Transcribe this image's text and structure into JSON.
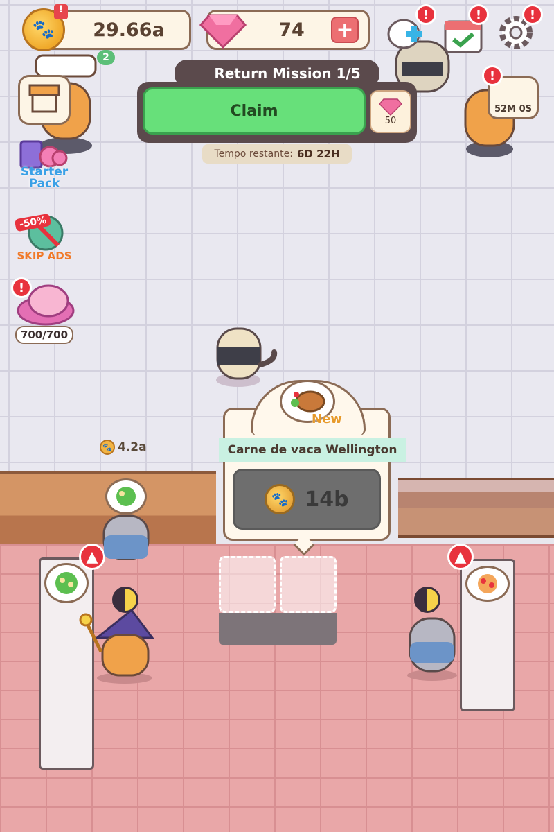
{
  "hud": {
    "coins": "29.66a",
    "coin_badge": "!",
    "gems": "74",
    "gem_plus": "+"
  },
  "top_icons": [
    {
      "name": "add-staff-icon",
      "alert": "!"
    },
    {
      "name": "calendar-check-icon",
      "alert": "!"
    },
    {
      "name": "gear-icon",
      "alert": "!"
    }
  ],
  "timer_badge": {
    "label": "52M 0S",
    "alert": "!"
  },
  "mission": {
    "title": "Return Mission 1/5",
    "claim_label": "Claim",
    "reward_amount": "50",
    "time_label": "Tempo restante:",
    "time_value": "6D 22H"
  },
  "sidebar": {
    "starter_pack": "Starter Pack",
    "skip_ads_discount": "-50%",
    "skip_ads": "SKIP ADS",
    "piggy_count": "700/700",
    "piggy_alert": "!",
    "friends_count": "2"
  },
  "dish": {
    "badge": "New",
    "name": "Carne de vaca Wellington",
    "price": "14b"
  },
  "income_label": "4.2a",
  "colors": {
    "claim_green": "#67e07a",
    "alert_red": "#e8323d",
    "coin_gold": "#f0a92a",
    "floor_pink": "#e9a7a8"
  }
}
